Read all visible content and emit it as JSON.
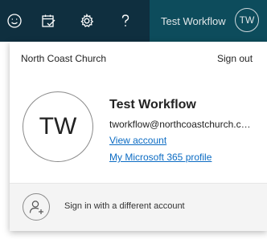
{
  "topbar": {
    "icons": [
      "smile-icon",
      "calendar-check-icon",
      "gear-icon",
      "help-icon"
    ],
    "user_name": "Test Workflow",
    "user_initials": "TW",
    "background": "#0f2f3f",
    "user_button_background": "#0d4c5c"
  },
  "account_panel": {
    "organization": "North Coast Church",
    "sign_out_label": "Sign out",
    "avatar_initials": "TW",
    "full_name": "Test Workflow",
    "email": "tworkflow@northcoastchurch.com",
    "view_account_label": "View account",
    "profile_link_label": "My Microsoft 365 profile",
    "link_color": "#0b6bc3"
  },
  "footer": {
    "label": "Sign in with a different account",
    "icon": "add-person-icon"
  }
}
